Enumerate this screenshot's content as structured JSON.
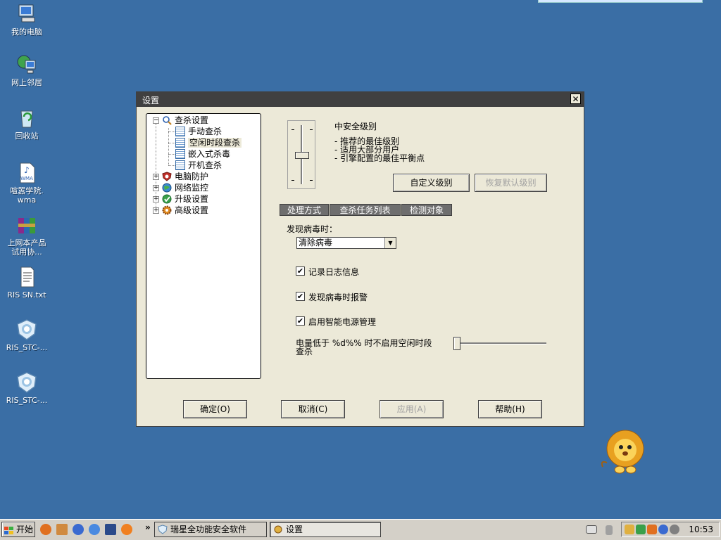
{
  "desktop": {
    "icons": [
      {
        "label": "我的电脑"
      },
      {
        "label": "网上邻居"
      },
      {
        "label": "回收站"
      },
      {
        "label": "喧嚣学院.\nwma"
      },
      {
        "label": "上网本产品\n试用协..."
      },
      {
        "label": "RIS SN.txt"
      },
      {
        "label": "RIS_STC-..."
      },
      {
        "label": "RIS_STC-..."
      }
    ]
  },
  "window": {
    "title": "设置",
    "close_glyph": "✕",
    "tree": {
      "root": "查杀设置",
      "children": [
        "手动查杀",
        "空闲时段查杀",
        "嵌入式杀毒",
        "开机查杀"
      ],
      "others": [
        "电脑防护",
        "网络监控",
        "升级设置",
        "高级设置"
      ]
    },
    "security": {
      "level_title": "中安全级别",
      "desc": [
        "- 推荐的最佳级别",
        "- 适用大部分用户",
        "- 引擎配置的最佳平衡点"
      ],
      "custom_button": "自定义级别",
      "restore_button": "恢复默认级别"
    },
    "tabs": [
      "处理方式",
      "查杀任务列表",
      "检测对象"
    ],
    "virus_found_label": "发现病毒时：",
    "virus_action": "清除病毒",
    "checkboxes": [
      {
        "label": "记录日志信息",
        "checked": true
      },
      {
        "label": "发现病毒时报警",
        "checked": true
      },
      {
        "label": "启用智能电源管理",
        "checked": true
      }
    ],
    "power_label_line1": "电量低于 %d%% 时不启用空闲时段",
    "power_label_line2": "查杀",
    "buttons": {
      "ok": "确定(O)",
      "cancel": "取消(C)",
      "apply": "应用(A)",
      "help": "帮助(H)"
    }
  },
  "taskbar": {
    "start": "开始",
    "chevron": "»",
    "tasks": [
      "瑞星全功能安全软件",
      "设置"
    ],
    "clock": "10:53"
  }
}
